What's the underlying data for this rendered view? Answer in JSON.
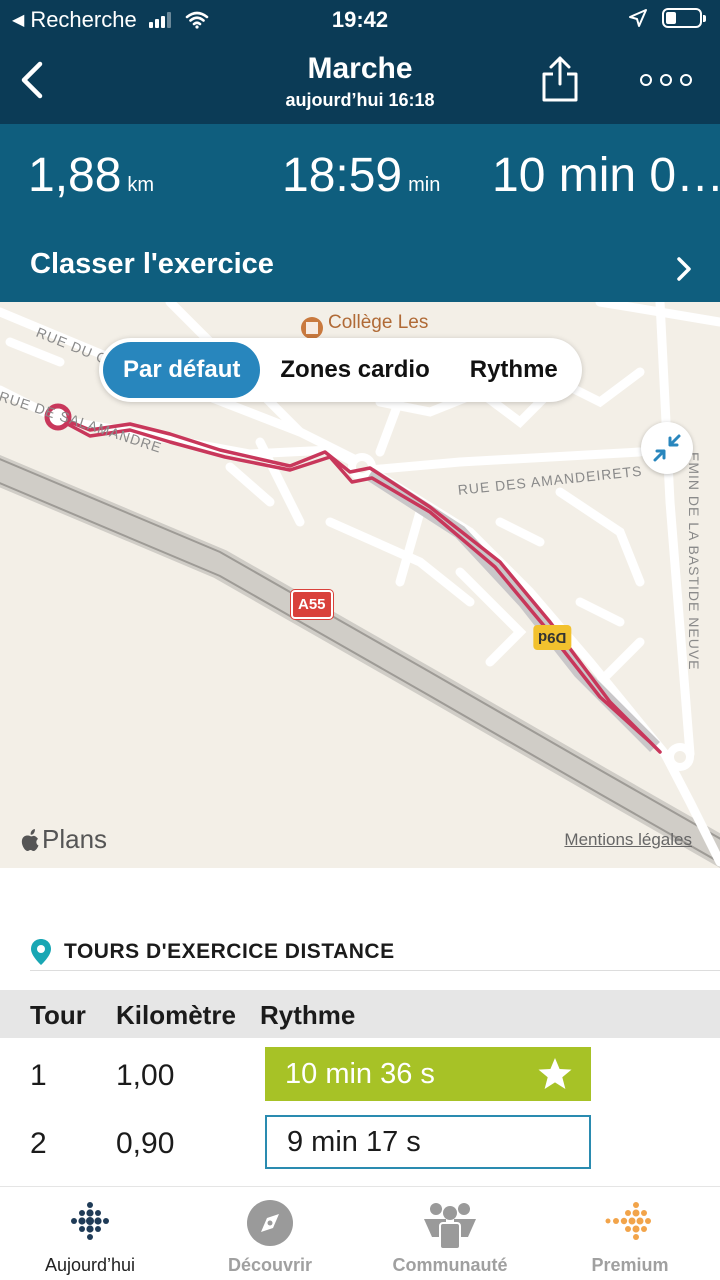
{
  "status_bar": {
    "back_app": "Recherche",
    "time": "19:42"
  },
  "header": {
    "title": "Marche",
    "subtitle": "aujourd’hui 16:18",
    "back_icon": "chevron-left-icon",
    "share_icon": "share-icon",
    "more_icon": "more-icon"
  },
  "stats": [
    {
      "value": "1,88",
      "unit": "km"
    },
    {
      "value": "18:59",
      "unit": "min"
    },
    {
      "value": "10 min 0…",
      "unit": ""
    }
  ],
  "classify": {
    "label": "Classer l'exercice"
  },
  "map": {
    "tabs": [
      "Par défaut",
      "Zones cardio",
      "Rythme"
    ],
    "active_tab": "Par défaut",
    "attribution": "Plans",
    "legal": "Mentions légales",
    "place_college": "Collège Les",
    "street_amandeirets": "RUE DES AMANDEIRETS",
    "street_gra": "RUE DU GRA",
    "street_salamandre": "RUE DE SALAMANDRE",
    "street_bastide": "EMIN DE LA BASTIDE NEUVE",
    "shield_a55": "A55",
    "shield_d9d": "D9d",
    "route_color": "#c8375b"
  },
  "laps": {
    "title": "TOURS D'EXERCICE DISTANCE",
    "columns": [
      "Tour",
      "Kilomètre",
      "Rythme"
    ],
    "rows": [
      {
        "lap": "1",
        "km": "1,00",
        "pace": "10 min 36 s",
        "best": true
      },
      {
        "lap": "2",
        "km": "0,90",
        "pace": "9 min 17 s",
        "best": false
      }
    ]
  },
  "tabbar": [
    {
      "label": "Aujourd’hui",
      "icon": "today-dots-icon",
      "active": true
    },
    {
      "label": "Découvrir",
      "icon": "compass-icon",
      "active": false
    },
    {
      "label": "Communauté",
      "icon": "community-icon",
      "active": false
    },
    {
      "label": "Premium",
      "icon": "premium-dots-icon",
      "active": false
    }
  ],
  "colors": {
    "header": "#0b3b56",
    "stats_band": "#0f5e7e",
    "accent": "#2886bd",
    "best_pace": "#a7c226"
  }
}
